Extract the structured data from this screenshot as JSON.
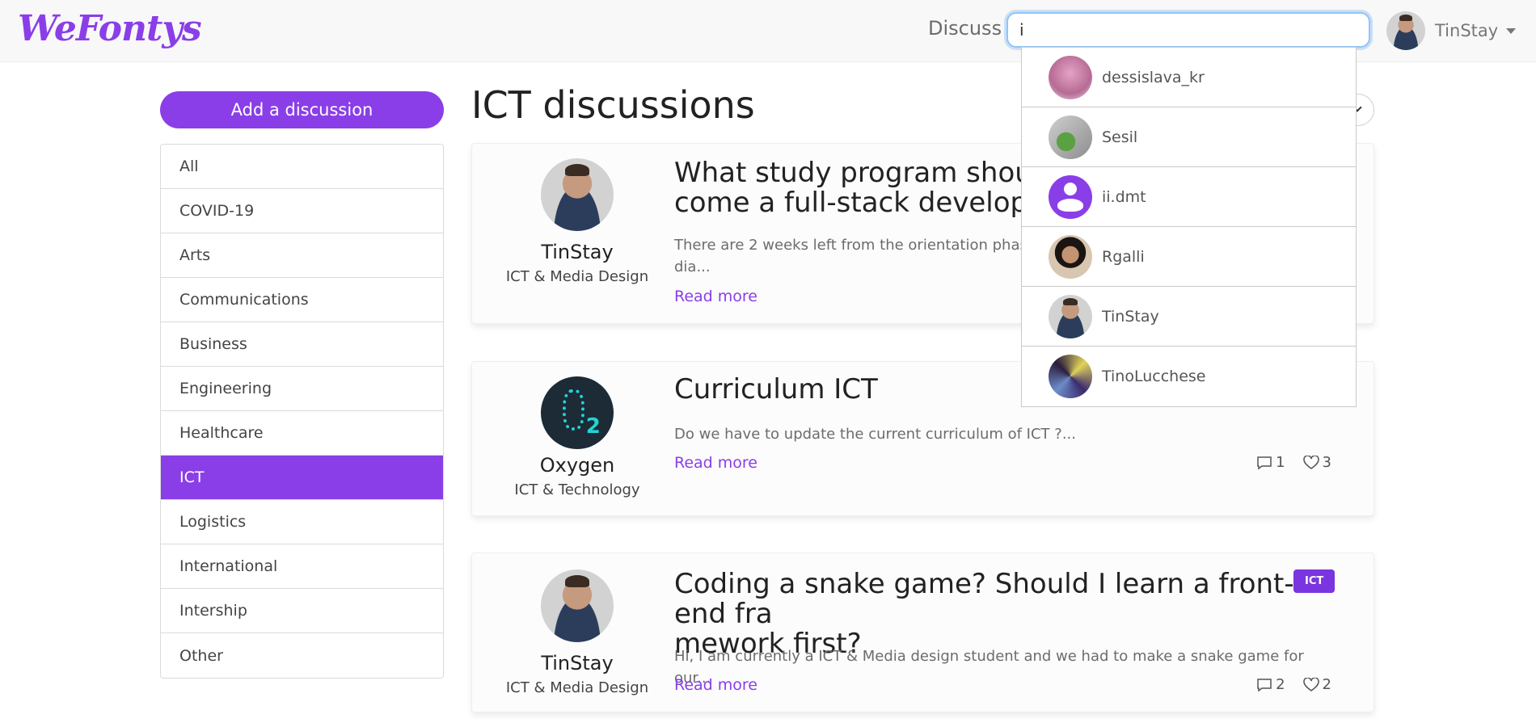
{
  "navbar": {
    "brand": "WeFontys",
    "discuss_label": "Discuss",
    "search_value": "i",
    "user_name": "TinStay"
  },
  "sidebar": {
    "add_button_label": "Add a discussion",
    "categories": [
      {
        "label": "All",
        "active": false
      },
      {
        "label": "COVID-19",
        "active": false
      },
      {
        "label": "Arts",
        "active": false
      },
      {
        "label": "Communications",
        "active": false
      },
      {
        "label": "Business",
        "active": false
      },
      {
        "label": "Engineering",
        "active": false
      },
      {
        "label": "Healthcare",
        "active": false
      },
      {
        "label": "ICT",
        "active": true
      },
      {
        "label": "Logistics",
        "active": false
      },
      {
        "label": "International",
        "active": false
      },
      {
        "label": "Intership",
        "active": false
      },
      {
        "label": "Other",
        "active": false
      }
    ]
  },
  "main": {
    "title": "ICT discussions",
    "discussions": [
      {
        "author": "TinStay",
        "program": "ICT & Media Design",
        "title": "What study program should I ... become a full-stack developer?",
        "title_line1": "What study program should I",
        "title_line2": "come a full-stack developer?",
        "excerpt": "There are 2 weeks left from the orientation phase a",
        "excerpt_line2": "dia...",
        "read_more": "Read more"
      },
      {
        "author": "Oxygen",
        "program": "ICT & Technology",
        "title": "Curriculum ICT",
        "excerpt": "Do we have to update the current curriculum of ICT ?...",
        "read_more": "Read more",
        "comments": "1",
        "likes": "3"
      },
      {
        "author": "TinStay",
        "program": "ICT & Media Design",
        "title_line1": "Coding a snake game? Should I learn a front-end fra",
        "title_line2": "mework first?",
        "excerpt": "Hi, I am currently a ICT & Media design student and we had to make a snake game for our...",
        "read_more": "Read more",
        "tag": "ICT",
        "comments": "2",
        "likes": "2"
      }
    ]
  },
  "search_results": [
    {
      "name": "dessislava_kr",
      "avatar": "pink-photo"
    },
    {
      "name": "Sesil",
      "avatar": "green-photo"
    },
    {
      "name": "ii.dmt",
      "avatar": "default-user-icon"
    },
    {
      "name": "Rgalli",
      "avatar": "glasses-photo"
    },
    {
      "name": "TinStay",
      "avatar": "person-photo"
    },
    {
      "name": "TinoLucchese",
      "avatar": "abstract-photo"
    }
  ],
  "colors": {
    "accent": "#8a3ee8",
    "tag": "#7a34e0",
    "navbar_bg": "#f8f8f8"
  }
}
